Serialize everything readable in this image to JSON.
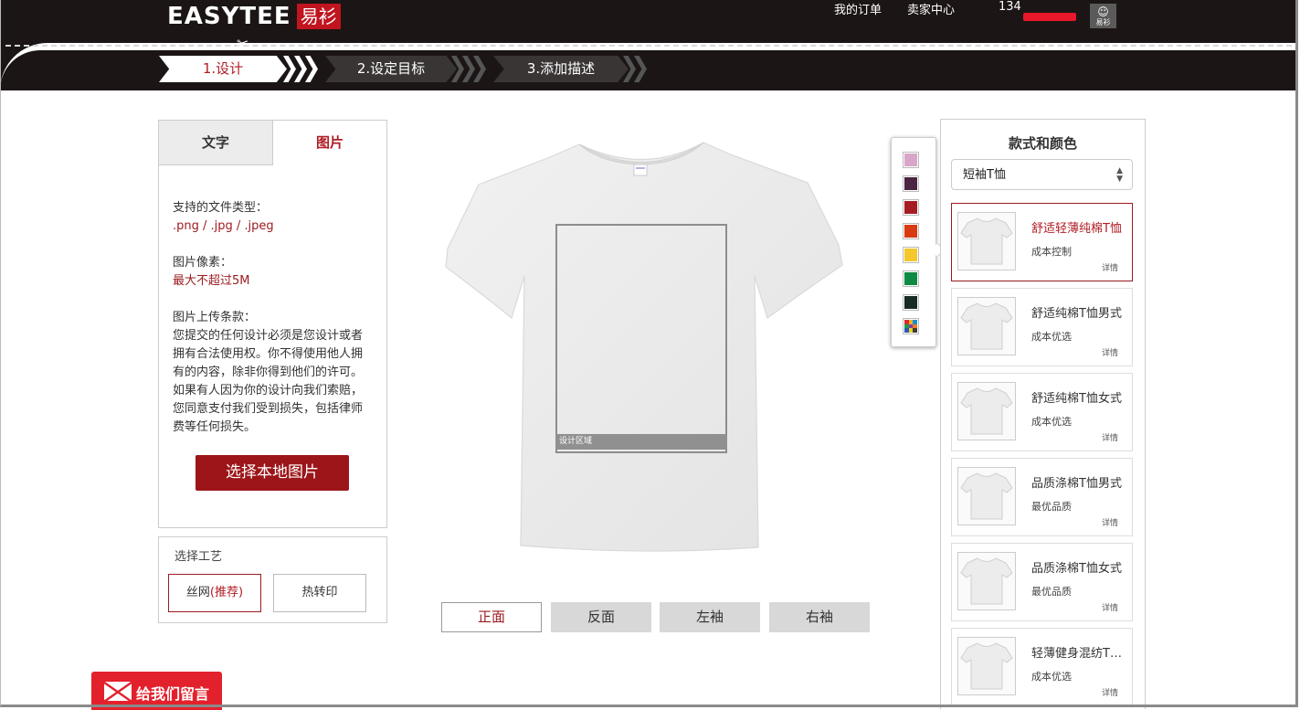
{
  "header": {
    "logo_en": "EASYTEE",
    "logo_cn": "易衫",
    "nav": {
      "orders": "我的订单",
      "seller": "卖家中心",
      "phone": "134"
    },
    "avatar_label": "易衫"
  },
  "steps": [
    "1.设计",
    "2.设定目标",
    "3.添加描述"
  ],
  "left_panel": {
    "tabs": {
      "text": "文字",
      "image": "图片"
    },
    "file_types_label": "支持的文件类型：",
    "file_types_value": ".png / .jpg / .jpeg",
    "pixel_label": "图片像素：",
    "pixel_value": "最大不超过5M",
    "terms_label": "图片上传条款：",
    "terms_text": "您提交的任何设计必须是您设计或者拥有合法使用权。你不得使用他人拥有的内容，除非你得到他们的许可。如果有人因为你的设计向我们索赔，您同意支付我们受到损失，包括律师费等任何损失。",
    "upload_button": "选择本地图片"
  },
  "craft": {
    "title": "选择工艺",
    "silk": "丝网",
    "silk_rec": "(推荐)",
    "heat": "热转印"
  },
  "canvas": {
    "design_area_label": "设计区域",
    "views": [
      "正面",
      "反面",
      "左袖",
      "右袖"
    ],
    "selected_view": "正面"
  },
  "colors": [
    "#d9a6c8",
    "#4a2440",
    "#a51d23",
    "#d83a12",
    "#f4c72a",
    "#0e8a45",
    "#172a24"
  ],
  "multi_color_swatch": [
    "#e0282e",
    "#f2b51b",
    "#1b8fd6",
    "#14a04a",
    "#8e3aa8",
    "#f27a1d",
    "#2a57b8",
    "#e8d21c",
    "#3c3c3c"
  ],
  "right_panel": {
    "title": "款式和颜色",
    "select_value": "短袖T恤",
    "products": [
      {
        "name": "舒适轻薄纯棉T恤",
        "sub": "成本控制",
        "detail": "详情",
        "selected": true
      },
      {
        "name": "舒适纯棉T恤男式",
        "sub": "成本优选",
        "detail": "详情",
        "selected": false
      },
      {
        "name": "舒适纯棉T恤女式",
        "sub": "成本优选",
        "detail": "详情",
        "selected": false
      },
      {
        "name": "品质涤棉T恤男式",
        "sub": "最优品质",
        "detail": "详情",
        "selected": false
      },
      {
        "name": "品质涤棉T恤女式",
        "sub": "最优品质",
        "detail": "详情",
        "selected": false
      },
      {
        "name": "轻薄健身混纺T…",
        "sub": "成本优选",
        "detail": "详情",
        "selected": false
      }
    ]
  },
  "message_button": "给我们留言"
}
